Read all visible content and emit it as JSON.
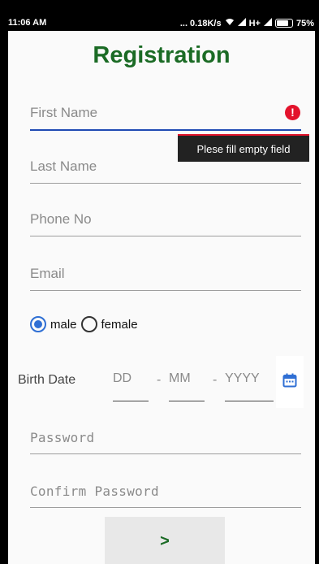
{
  "status_bar": {
    "time": "11:06 AM",
    "network_speed": "... 0.18K/s",
    "network_type": "H+",
    "battery": "75%"
  },
  "form": {
    "title": "Registration",
    "first_name": {
      "placeholder": "First Name",
      "value": "",
      "error_icon": "error-icon",
      "error": "Plese fill empty field"
    },
    "last_name": {
      "placeholder": "Last Name",
      "value": ""
    },
    "phone": {
      "placeholder": "Phone No",
      "value": ""
    },
    "email": {
      "placeholder": "Email",
      "value": ""
    },
    "gender": {
      "options": [
        "male",
        "female"
      ],
      "selected": "male"
    },
    "birth_date": {
      "label": "Birth Date",
      "day_placeholder": "DD",
      "month_placeholder": "MM",
      "year_placeholder": "YYYY",
      "separator": "-",
      "calendar_icon": "calendar-icon"
    },
    "password": {
      "placeholder": "Password",
      "value": ""
    },
    "confirm_password": {
      "placeholder": "Confirm Password",
      "value": ""
    },
    "next_button": ">"
  },
  "colors": {
    "title_green": "#1b6b25",
    "accent_blue": "#1f4ab3",
    "radio_blue": "#2f6fd4",
    "error_red": "#e3132c"
  }
}
